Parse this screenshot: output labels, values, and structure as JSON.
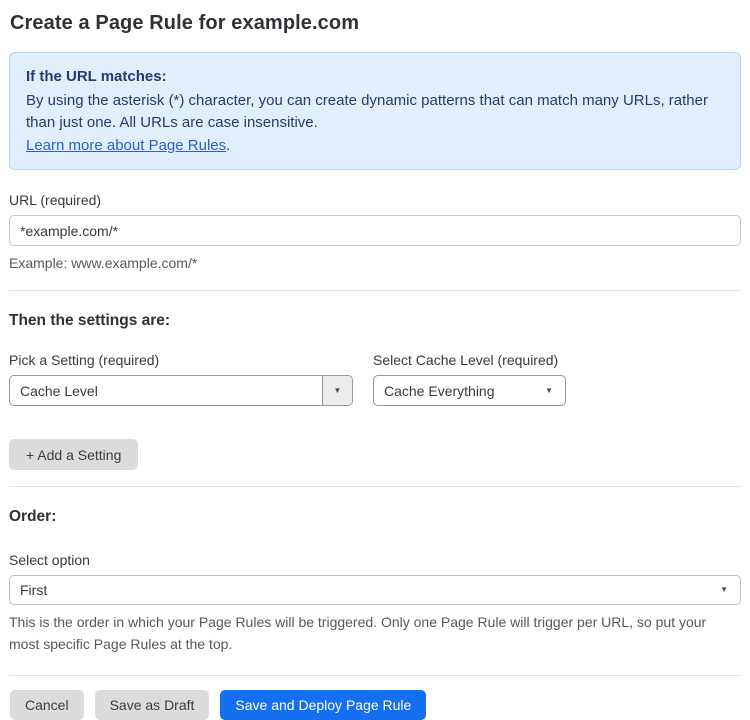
{
  "page": {
    "title": "Create a Page Rule for example.com"
  },
  "info_box": {
    "heading": "If the URL matches:",
    "body": "By using the asterisk (*) character, you can create dynamic patterns that can match many URLs, rather than just one. All URLs are case insensitive.",
    "link_label": "Learn more about Page Rules",
    "link_suffix": "."
  },
  "url_field": {
    "label": "URL (required)",
    "value": "*example.com/*",
    "helper": "Example: www.example.com/*"
  },
  "settings_section": {
    "heading": "Then the settings are:",
    "setting_select": {
      "label": "Pick a Setting (required)",
      "value": "Cache Level"
    },
    "cache_level_select": {
      "label": "Select Cache Level (required)",
      "value": "Cache Everything"
    },
    "add_setting_label": "+ Add a Setting"
  },
  "order_section": {
    "heading": "Order:",
    "select_label": "Select option",
    "select_value": "First",
    "helper": "This is the order in which your Page Rules will be triggered. Only one Page Rule will trigger per URL, so put your most specific Page Rules at the top."
  },
  "actions": {
    "cancel_label": "Cancel",
    "save_draft_label": "Save as Draft",
    "save_deploy_label": "Save and Deploy Page Rule"
  },
  "icons": {
    "dropdown_arrow": "▼"
  },
  "colors": {
    "accent_blue": "#1470f1",
    "info_background": "#e3eefc",
    "info_text": "#223c72",
    "link_blue": "#2862c6",
    "button_gray": "#dcdcdc"
  }
}
